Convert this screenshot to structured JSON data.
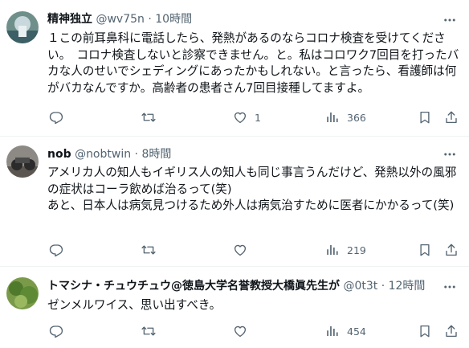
{
  "tweets": [
    {
      "name": "精神独立",
      "handle": "@wv75n",
      "sep": "·",
      "time": "10時間",
      "text": "１この前耳鼻科に電話したら、発熱があるのならコロナ検査を受けてください。　コロナ検査しないと診察できません。と。私はコロワク7回目を打ったバカな人のせいでシェディングにあったかもしれない。と言ったら、看護師は何がバカなんですか。高齢者の患者さん7回目接種してますよ。",
      "like_count": "1",
      "view_count": "366"
    },
    {
      "name": "nob",
      "handle": "@nobtwin",
      "sep": "·",
      "time": "8時間",
      "text": "アメリカ人の知人もイギリス人の知人も同じ事言うんだけど、発熱以外の風邪の症状はコーラ飲めば治るって(笑)\nあと、日本人は病気見つけるため外人は病気治すために医者にかかるって(笑)",
      "like_count": "",
      "view_count": "219"
    },
    {
      "name": "トマシナ・チュウチュウ@徳島大学名誉教授大橋眞先生が",
      "handle": "@0t3t",
      "sep": "·",
      "time": "12時間",
      "text": "ゼンメルワイス、思い出すべき。",
      "like_count": "",
      "view_count": "454"
    }
  ],
  "colors": {
    "text": "#0f1419",
    "secondary": "#536471",
    "divider": "#eff3f4"
  },
  "icons": [
    "more-icon",
    "reply-icon",
    "retweet-icon",
    "like-icon",
    "views-icon",
    "bookmark-icon",
    "share-icon"
  ]
}
